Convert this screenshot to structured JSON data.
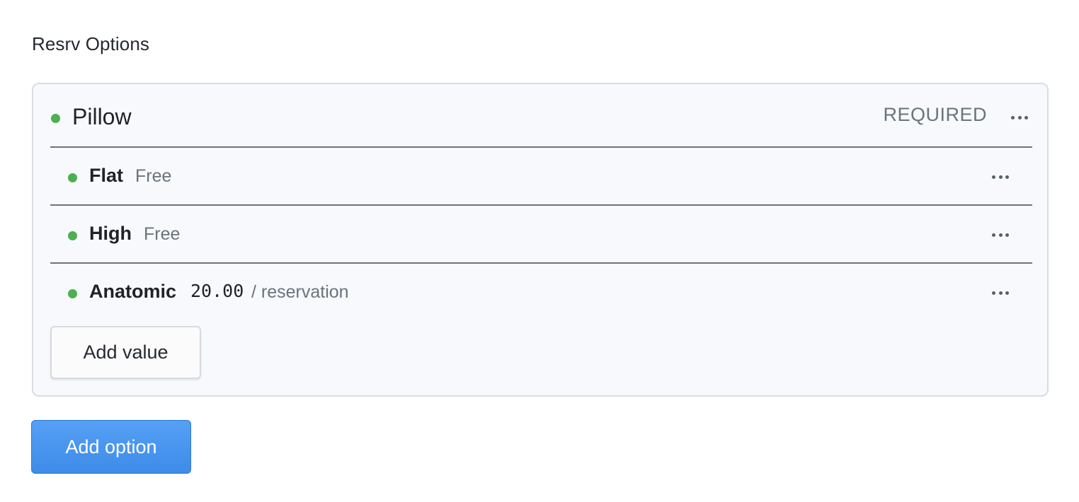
{
  "section": {
    "title": "Resrv Options"
  },
  "option": {
    "name": "Pillow",
    "badge": "REQUIRED",
    "status_color": "#4caf50",
    "values": [
      {
        "name": "Flat",
        "price": "Free"
      },
      {
        "name": "High",
        "price": "Free"
      },
      {
        "name": "Anatomic",
        "amount": "20.00",
        "unit": "/ reservation"
      }
    ],
    "add_value_label": "Add value"
  },
  "actions": {
    "add_option_label": "Add option",
    "accent": "#4a95ef"
  }
}
